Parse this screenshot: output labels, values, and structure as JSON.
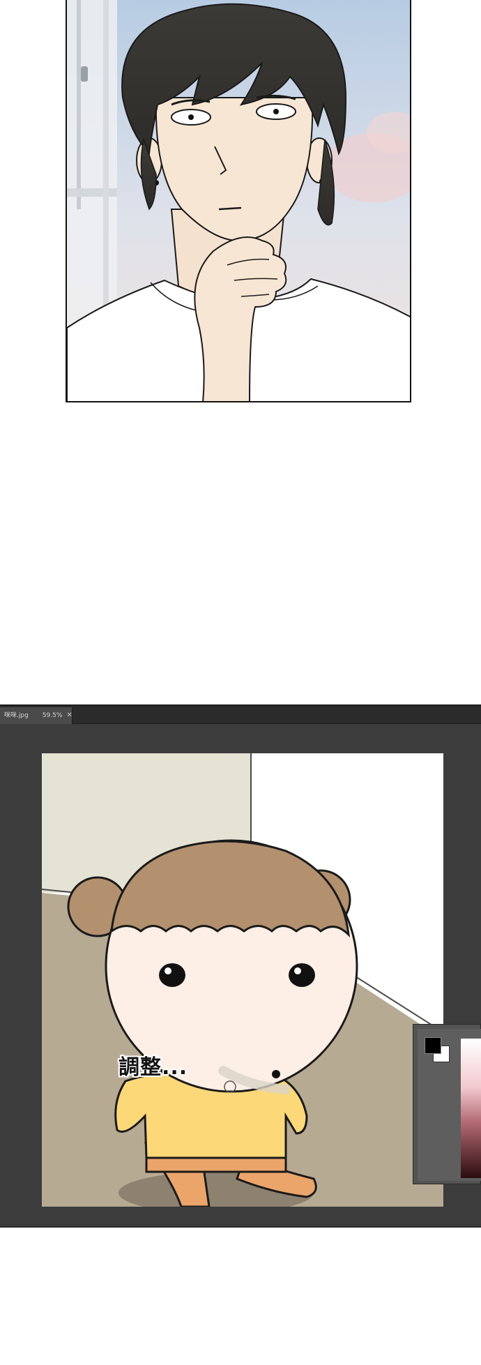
{
  "editor": {
    "tab": {
      "filename": "咪咪.jpg",
      "zoom": "59.5%",
      "close_glyph": "✕"
    },
    "swatches": {
      "foreground": "#000000",
      "background": "#ffffff"
    }
  },
  "caption": "調整..."
}
